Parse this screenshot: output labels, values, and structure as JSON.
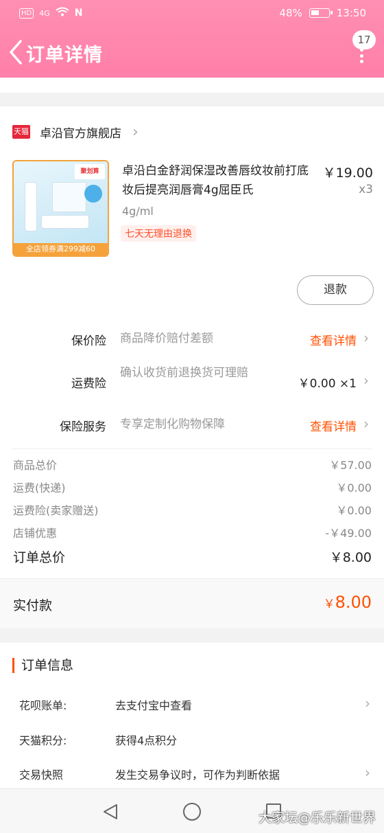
{
  "status_bar": {
    "left_badge": "HD",
    "signal": "4G",
    "nfc": "N",
    "battery_pct": "48%",
    "time": "13:50"
  },
  "header": {
    "title": "订单详情",
    "badge_count": "17"
  },
  "store": {
    "logo_text": "天猫",
    "name": "卓沿官方旗舰店"
  },
  "product": {
    "title": "卓沿白金舒润保湿改善唇纹妆前打底妆后提亮润唇膏4g屈臣氏",
    "price": "￥19.00",
    "qty": "x3",
    "spec": "4g/ml",
    "tag": "七天无理由退换",
    "image_badge": "聚划算",
    "image_banner": "全店领券满299减60",
    "refund_label": "退款"
  },
  "insurance": [
    {
      "label": "保价险",
      "desc": "商品降价赔付差额",
      "action": "查看详情"
    },
    {
      "label": "运费险",
      "desc": "确认收货前退换货可理赔",
      "value": "￥0.00 ×1"
    },
    {
      "label": "保险服务",
      "desc": "专享定制化购物保障",
      "action": "查看详情"
    }
  ],
  "summary": {
    "rows": [
      {
        "label": "商品总价",
        "value": "￥57.00"
      },
      {
        "label": "运费(快递)",
        "value": "￥0.00"
      },
      {
        "label": "运费险(卖家赠送)",
        "value": "￥0.00"
      },
      {
        "label": "店铺优惠",
        "value": "-￥49.00"
      }
    ],
    "total_label": "订单总价",
    "total_value": "￥8.00",
    "paid_label": "实付款",
    "paid_currency": "￥",
    "paid_value": "8.00"
  },
  "order_info": {
    "title": "订单信息",
    "rows": [
      {
        "key": "花呗账单:",
        "value": "去支付宝中查看"
      },
      {
        "key": "天猫积分:",
        "value": "获得4点积分"
      },
      {
        "key": "交易快照",
        "value": "发生交易争议时，可作为判断依据"
      }
    ]
  },
  "watermark": "大家坛@乐乐新世界",
  "colors": {
    "header_pink": "#ff85ae",
    "accent_orange": "#ff5000",
    "tmall_red": "#e5263a"
  }
}
